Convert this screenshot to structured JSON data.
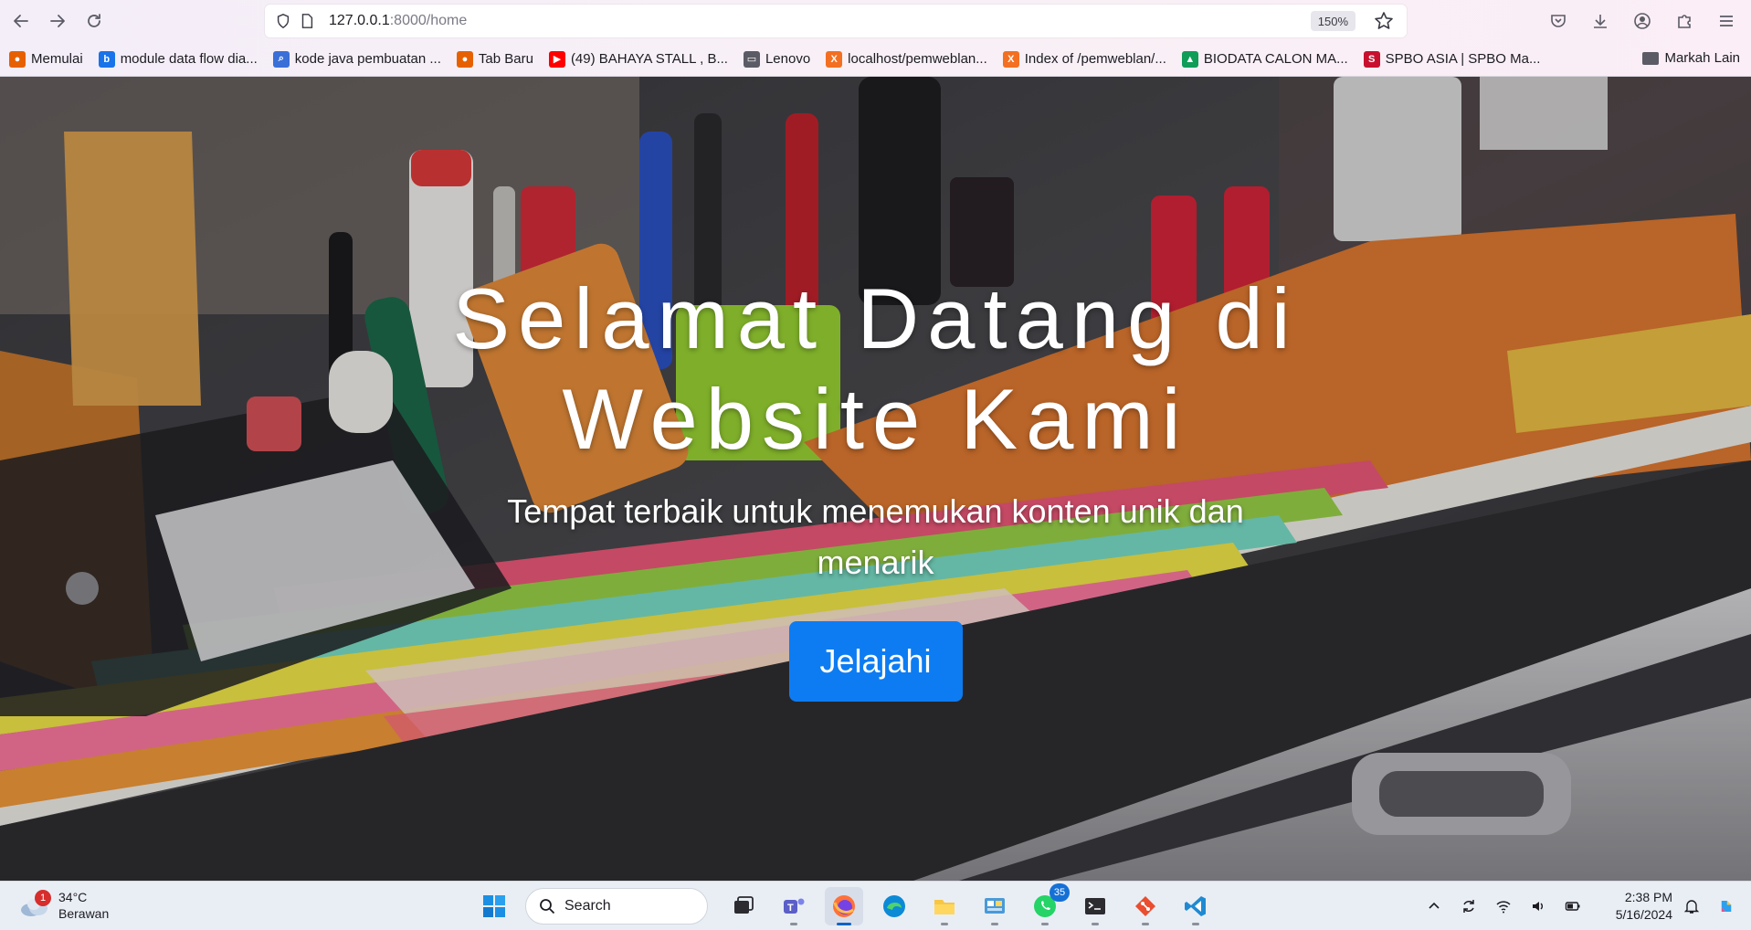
{
  "browser": {
    "url_host": "127.0.0.1",
    "url_rest": ":8000/home",
    "zoom": "150%"
  },
  "bookmarks": [
    {
      "label": "Memulai",
      "icon": "firefox-icon",
      "color": "#e66000"
    },
    {
      "label": "module data flow dia...",
      "icon": "bing-icon",
      "color": "#1a73e8"
    },
    {
      "label": "kode java pembuatan ...",
      "icon": "search-icon",
      "color": "#3a6fd8"
    },
    {
      "label": "Tab Baru",
      "icon": "firefox-icon",
      "color": "#e66000"
    },
    {
      "label": "(49) BAHAYA STALL , B...",
      "icon": "youtube-icon",
      "color": "#ff0000"
    },
    {
      "label": "Lenovo",
      "icon": "folder-icon",
      "color": "#5b5b66"
    },
    {
      "label": "localhost/pemweblan...",
      "icon": "xampp-icon",
      "color": "#f36f21"
    },
    {
      "label": "Index of /pemweblan/...",
      "icon": "xampp-icon",
      "color": "#f36f21"
    },
    {
      "label": "BIODATA CALON MA...",
      "icon": "google-drive-icon",
      "color": "#0f9d58"
    },
    {
      "label": "SPBO ASIA | SPBO Ma...",
      "icon": "spbo-icon",
      "color": "#c8102e"
    }
  ],
  "bookmarks_other": "Markah Lain",
  "hero": {
    "title": "Selamat Datang di Website Kami",
    "subtitle": "Tempat terbaik untuk menemukan konten unik dan menarik",
    "button": "Jelajahi"
  },
  "taskbar": {
    "weather_temp": "34°C",
    "weather_desc": "Berawan",
    "weather_badge": "1",
    "search_placeholder": "Search",
    "whatsapp_badge": "35",
    "time": "2:38 PM",
    "date": "5/16/2024"
  },
  "colors": {
    "button_blue": "#0d7cf2",
    "accent": "#0d63c9"
  }
}
